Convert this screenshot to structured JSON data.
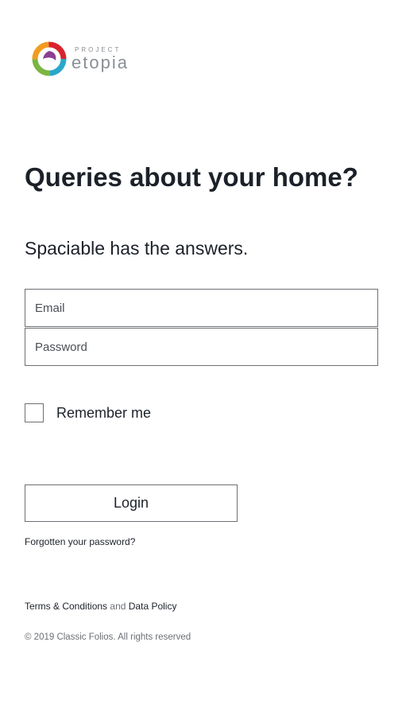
{
  "brand": {
    "logo_top_text": "PROJECT",
    "logo_word": "etopia",
    "colors": {
      "ring_red": "#d9232d",
      "ring_orange": "#f29c1f",
      "ring_green": "#7bb542",
      "ring_blue": "#2aa8c9",
      "ring_purple": "#8a3f94"
    }
  },
  "hero": {
    "headline": "Queries about your home?",
    "subheadline": "Spaciable has the answers."
  },
  "form": {
    "email_placeholder": "Email",
    "password_placeholder": "Password",
    "remember_label": "Remember me",
    "login_label": "Login",
    "forgot_link": "Forgotten your password?"
  },
  "footer": {
    "terms_link": "Terms & Conditions",
    "and_text": "and",
    "data_policy_link": "Data Policy",
    "copyright": "© 2019 Classic Folios. All rights reserved"
  }
}
